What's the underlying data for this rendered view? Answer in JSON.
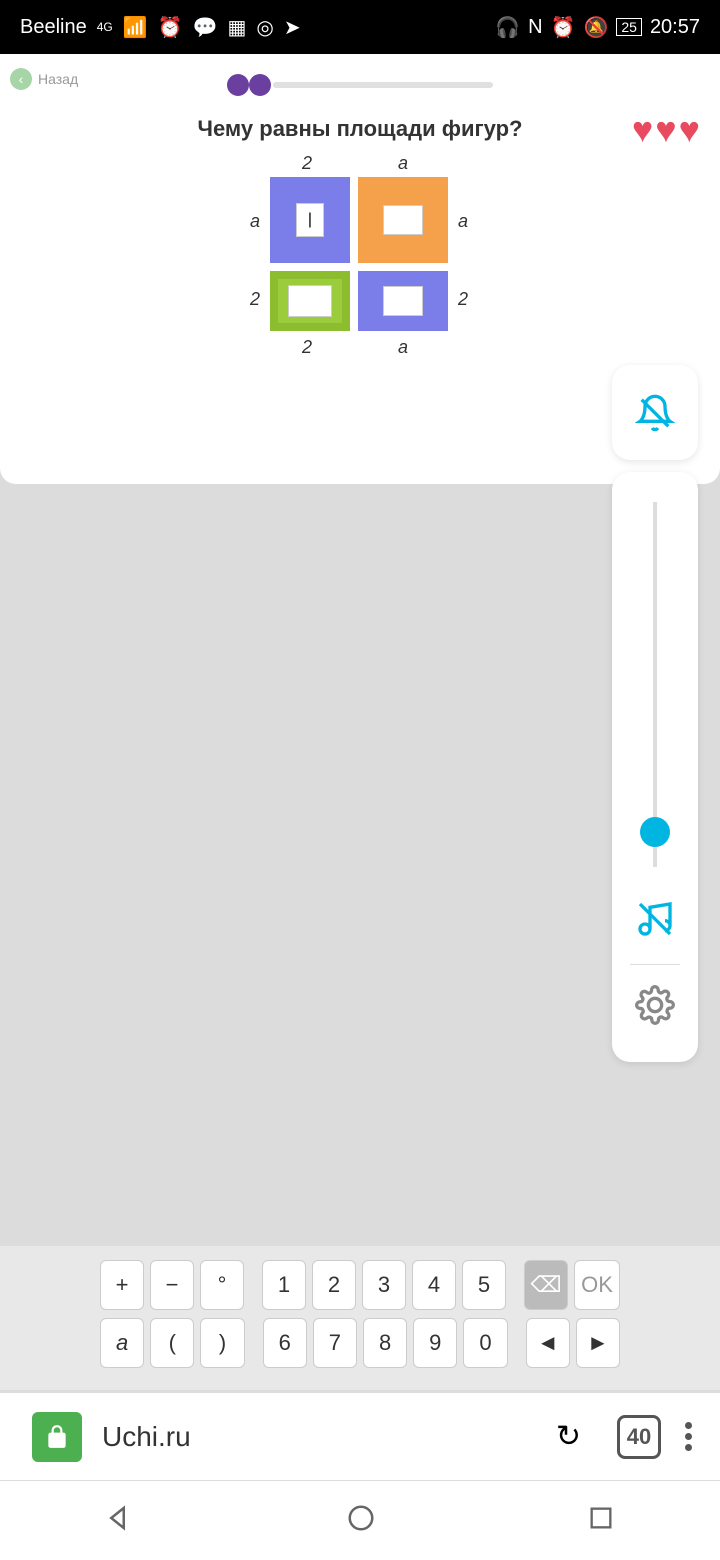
{
  "status": {
    "carrier": "Beeline",
    "network": "4G",
    "battery": "25",
    "time": "20:57"
  },
  "nav": {
    "back_label": "Назад"
  },
  "task": {
    "question": "Чему равны площади фигур?",
    "dims": {
      "top_left": "2",
      "top_right": "a",
      "left": "a",
      "right": "a",
      "mid_left": "2",
      "mid_right": "2",
      "bot_left": "2",
      "bot_right": "a"
    }
  },
  "keyboard": {
    "row1": [
      "+",
      "−",
      "°",
      "1",
      "2",
      "3",
      "4",
      "5"
    ],
    "backspace": "⌫",
    "ok": "OK",
    "row2": [
      "a",
      "(",
      ")",
      "6",
      "7",
      "8",
      "9",
      "0",
      "◄",
      "►"
    ]
  },
  "browser": {
    "url": "Uchi.ru",
    "tabs": "40"
  }
}
